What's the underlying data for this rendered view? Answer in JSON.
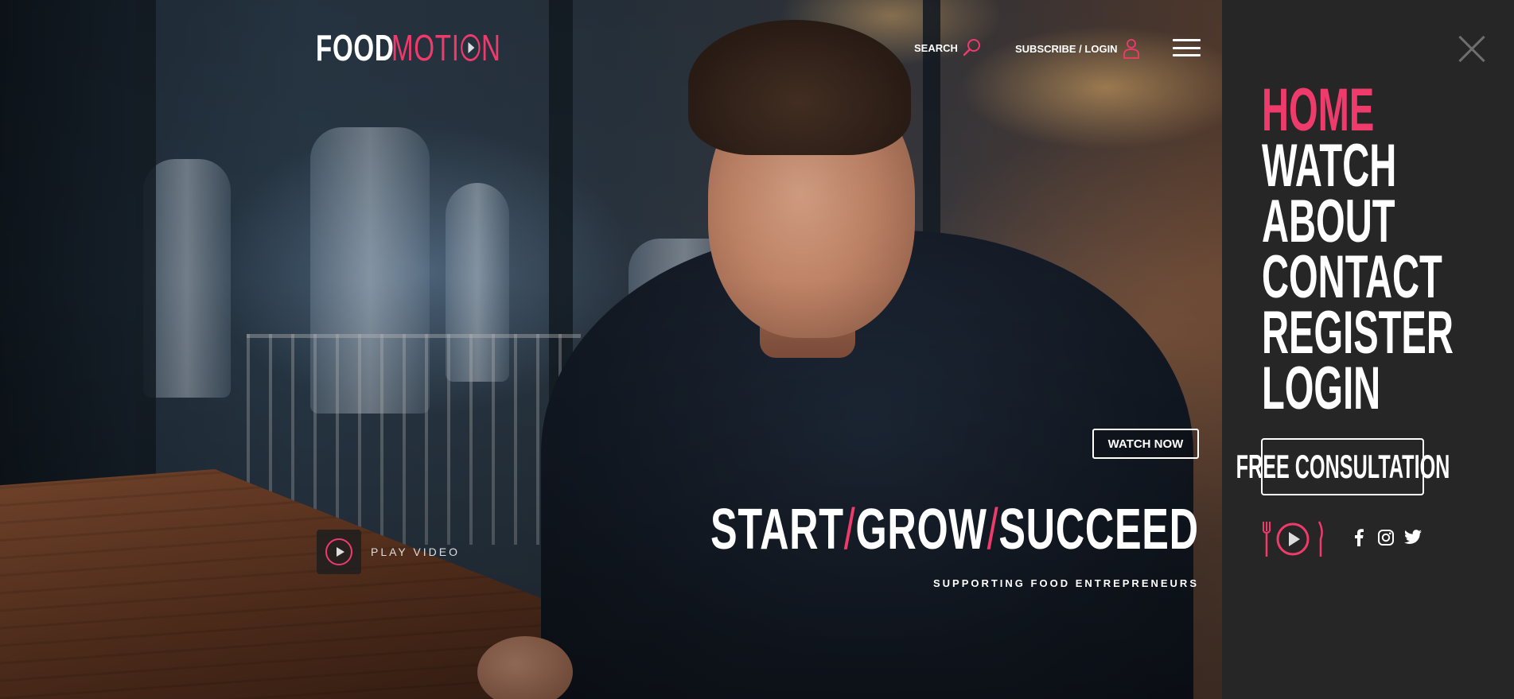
{
  "brand": {
    "name_part1": "FOOD",
    "name_part2_pre": "MOTI",
    "name_part2_post": "N",
    "accent_color": "#ef3b6b"
  },
  "header": {
    "search_label": "SEARCH",
    "search_icon": "search-icon",
    "login_label": "SUBSCRIBE / LOGIN",
    "login_icon": "user-icon",
    "menu_icon": "hamburger-menu-icon"
  },
  "hero": {
    "watch_now": "WATCH NOW",
    "tagline": {
      "word1": "START",
      "sep": "/",
      "word2": "GROW",
      "word3": "SUCCEED"
    },
    "subtitle": "SUPPORTING FOOD ENTREPRENEURS",
    "play_video": "PLAY VIDEO"
  },
  "side_menu": {
    "close_icon": "close-icon",
    "items": [
      {
        "label": "HOME",
        "active": true
      },
      {
        "label": "WATCH",
        "active": false
      },
      {
        "label": "ABOUT",
        "active": false
      },
      {
        "label": "CONTACT",
        "active": false
      },
      {
        "label": "REGISTER",
        "active": false
      },
      {
        "label": "LOGIN",
        "active": false
      }
    ],
    "cta": "FREE CONSULTATION",
    "social": [
      "facebook-icon",
      "instagram-icon",
      "twitter-icon"
    ]
  }
}
